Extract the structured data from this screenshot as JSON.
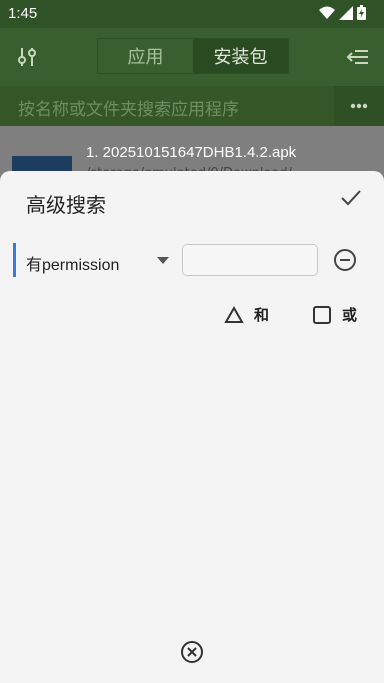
{
  "status_bar": {
    "time": "1:45"
  },
  "toolbar": {
    "tabs": [
      {
        "label": "应用",
        "selected": false
      },
      {
        "label": "安装包",
        "selected": true
      }
    ]
  },
  "search": {
    "placeholder": "按名称或文件夹搜索应用程序"
  },
  "list": {
    "item1_title": "1. 202510151647DHB1.4.2.apk",
    "item1_sub": "/storage/emulated/0/Download/"
  },
  "dialog": {
    "title": "高级搜索",
    "condition": {
      "field_label": "有permission",
      "value": ""
    },
    "options": [
      {
        "label": "和",
        "icon": "triangle-icon"
      },
      {
        "label": "或",
        "icon": "checkbox-icon",
        "checked": false
      }
    ]
  },
  "colors": {
    "accent": "#3a7bd5",
    "toolbar": "#3a5f2f",
    "sheet": "#f4f4f4"
  }
}
